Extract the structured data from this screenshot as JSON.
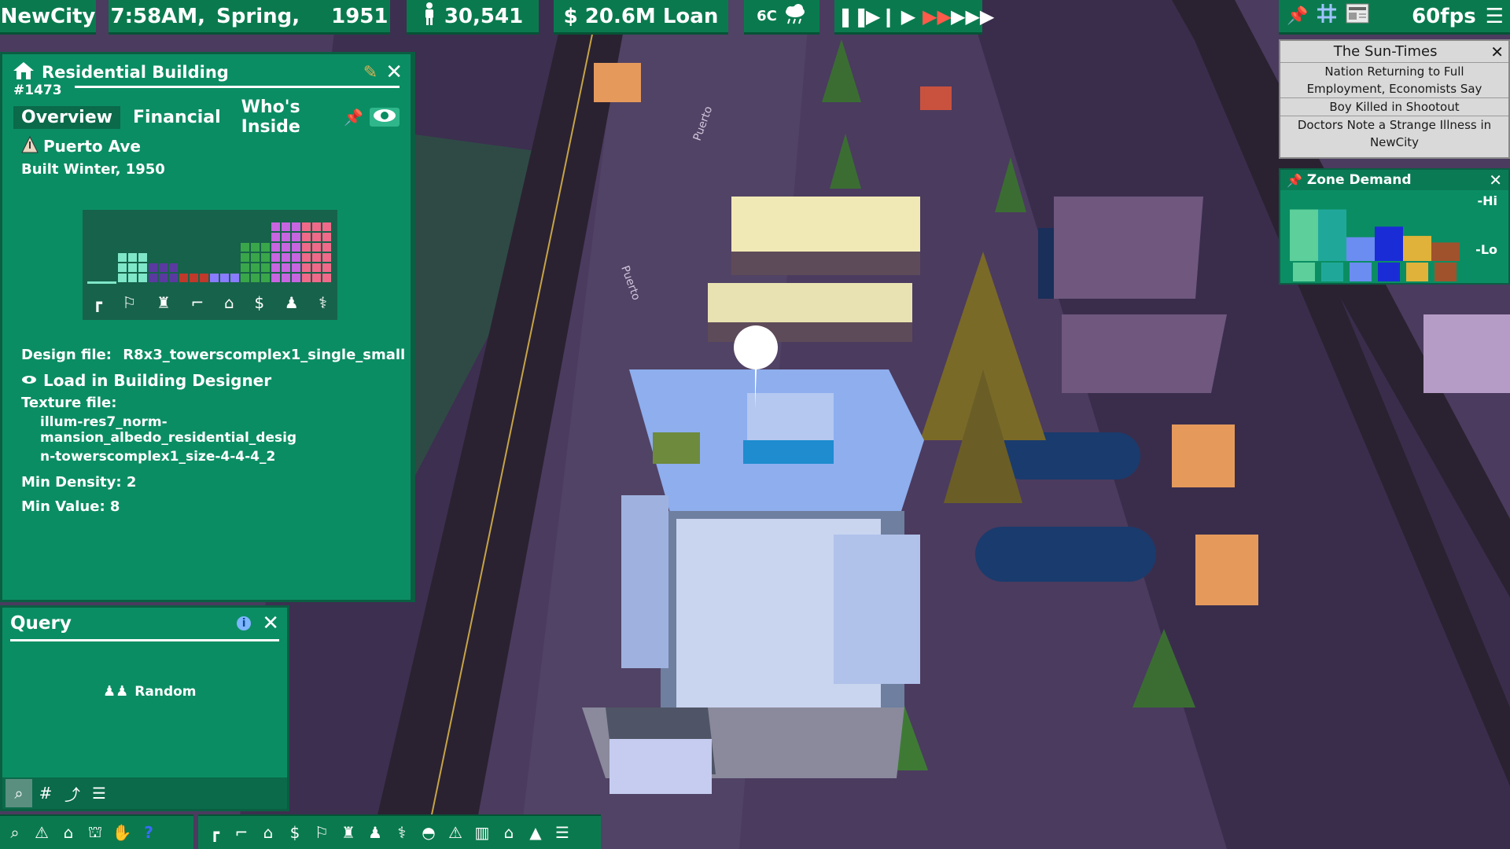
{
  "topbar": {
    "city_name": "NewCity",
    "time": "7:58AM,",
    "season": "Spring,",
    "year": "1951",
    "population": "30,541",
    "money": "$ 20.6M Loan",
    "temperature": "6C",
    "fps": "60fps"
  },
  "building_panel": {
    "title": "Residential Building",
    "id": "#1473",
    "tabs": [
      "Overview",
      "Financial",
      "Who's Inside"
    ],
    "street": "Puerto Ave",
    "built": "Built Winter, 1950",
    "design_file_label": "Design file:",
    "design_file": "R8x3_towerscomplex1_single_small",
    "load_designer": "Load in Building Designer",
    "texture_file_label": "Texture file:",
    "texture_file_line1": "illum-res7_norm-mansion_albedo_residential_desig",
    "texture_file_line2": "n-towerscomplex1_size-4-4-4_2",
    "min_density": "Min Density: 2",
    "min_value": "Min Value: 8",
    "stats": [
      {
        "name": "commute",
        "value": 0.0,
        "color": "#7fe6c8"
      },
      {
        "name": "education",
        "value": 0.4,
        "color": "#7fe6c8"
      },
      {
        "name": "crime",
        "value": 0.2,
        "color": "#5a3aa0"
      },
      {
        "name": "police",
        "value": 0.1,
        "color": "#c0392b"
      },
      {
        "name": "law",
        "value": 0.1,
        "color": "#8a7cff"
      },
      {
        "name": "community",
        "value": 0.55,
        "color": "#3aa64a"
      },
      {
        "name": "density",
        "value": 0.7,
        "color": "#c865e0"
      },
      {
        "name": "health",
        "value": 0.7,
        "color": "#f06a8a"
      }
    ]
  },
  "query_panel": {
    "title": "Query",
    "item_label": "Random"
  },
  "newspaper": {
    "title": "The Sun-Times",
    "headlines": [
      "Nation Returning to Full Employment, Economists Say",
      "Boy Killed in Shootout",
      "Doctors Note a Strange Illness in NewCity"
    ]
  },
  "zone_demand": {
    "title": "Zone Demand",
    "hi_label": "-Hi",
    "lo_label": "-Lo",
    "bars": [
      {
        "zone": "residential",
        "value": 0.78,
        "color": "#5ccf9a"
      },
      {
        "zone": "mixed-use",
        "value": 0.78,
        "color": "#1fa89a"
      },
      {
        "zone": "retail",
        "value": 0.36,
        "color": "#6b8cf0"
      },
      {
        "zone": "office",
        "value": 0.52,
        "color": "#1a2cd6"
      },
      {
        "zone": "farm",
        "value": 0.38,
        "color": "#e0b23a"
      },
      {
        "zone": "industrial",
        "value": 0.28,
        "color": "#a0522d"
      }
    ]
  },
  "colors": {
    "panel": "#0b8d63",
    "panel_header": "#0a7a55",
    "topbar": "#0a7a4e"
  }
}
